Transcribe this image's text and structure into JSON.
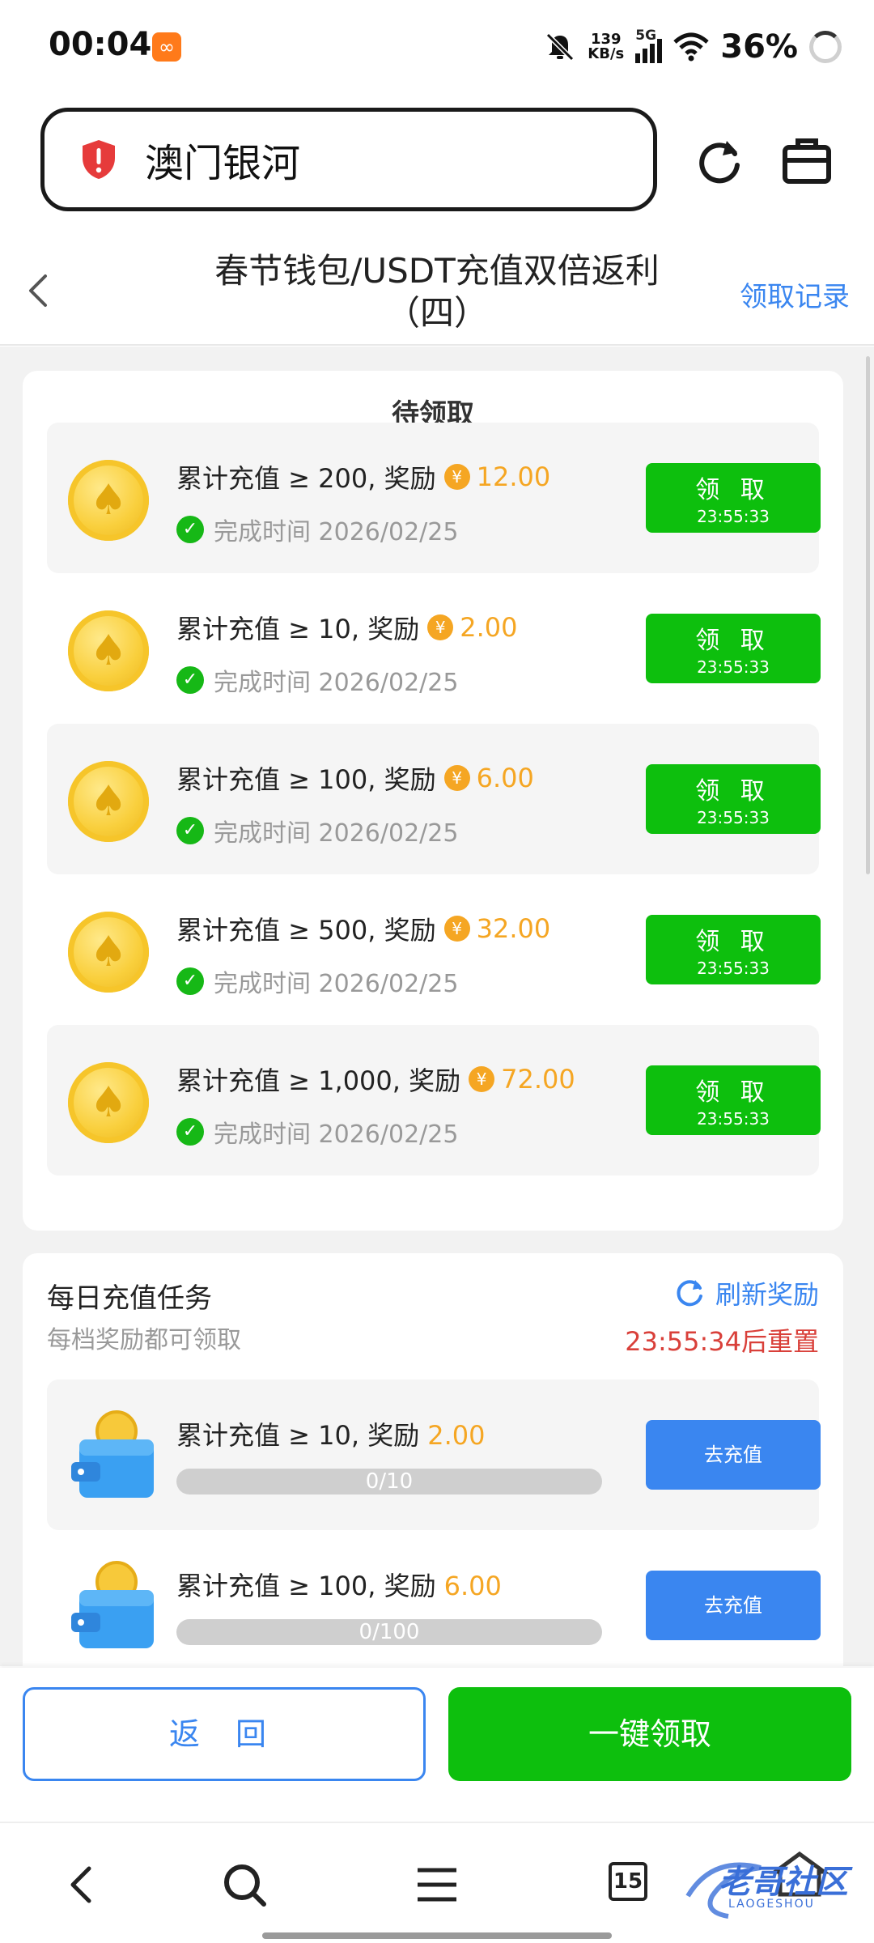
{
  "status_bar": {
    "time": "00:04",
    "app_icon": "∞",
    "net_speed_value": "139",
    "net_speed_unit": "KB/s",
    "network_type": "5G",
    "battery": "36%"
  },
  "browser": {
    "url_text": "澳门银河",
    "security_icon": "warning-shield-icon",
    "accent_color": "#3a86f0"
  },
  "header": {
    "title_line1": "春节钱包/USDT充值双倍返利",
    "title_line2": "（四）",
    "claim_record": "领取记录"
  },
  "pending": {
    "heading": "待领取",
    "items": [
      {
        "title": "累计充值 ≥ 200, 奖励",
        "yen": "¥",
        "amount": "12.00",
        "done": "完成时间 2026/02/25",
        "button": "领 取",
        "timer": "23:55:33"
      },
      {
        "title": "累计充值 ≥ 10, 奖励",
        "yen": "¥",
        "amount": "2.00",
        "done": "完成时间 2026/02/25",
        "button": "领 取",
        "timer": "23:55:33"
      },
      {
        "title": "累计充值 ≥ 100, 奖励",
        "yen": "¥",
        "amount": "6.00",
        "done": "完成时间 2026/02/25",
        "button": "领 取",
        "timer": "23:55:33"
      },
      {
        "title": "累计充值 ≥ 500, 奖励",
        "yen": "¥",
        "amount": "32.00",
        "done": "完成时间 2026/02/25",
        "button": "领 取",
        "timer": "23:55:33"
      },
      {
        "title": "累计充值 ≥ 1,000, 奖励",
        "yen": "¥",
        "amount": "72.00",
        "done": "完成时间 2026/02/25",
        "button": "领 取",
        "timer": "23:55:33"
      }
    ]
  },
  "daily": {
    "title": "每日充值任务",
    "subtitle": "每档奖励都可领取",
    "refresh": "刷新奖励",
    "reset": "23:55:34后重置",
    "tasks": [
      {
        "title": "累计充值 ≥ 10, 奖励",
        "amount": "2.00",
        "progress": "0/10",
        "progress_fraction": 0,
        "button": "去充值"
      },
      {
        "title": "累计充值 ≥ 100, 奖励",
        "amount": "6.00",
        "progress": "0/100",
        "progress_fraction": 0,
        "button": "去充值"
      }
    ]
  },
  "actions": {
    "return": "返 回",
    "claim_all": "一键领取"
  },
  "nav": {
    "tabs_count": "15",
    "watermark": "老哥社区",
    "watermark_sub": "LAOGESHOU"
  }
}
